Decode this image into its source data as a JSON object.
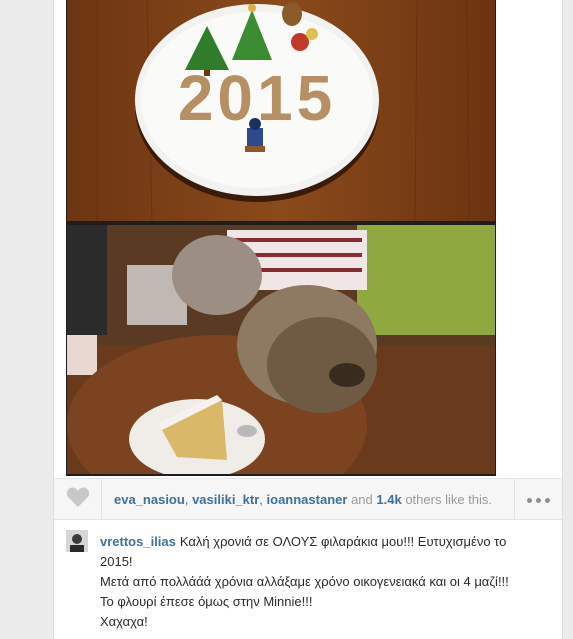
{
  "post": {
    "likers": [
      "eva_nasiou",
      "vasiliki_ktr",
      "ioannastaner"
    ],
    "likes_and": "and",
    "likes_count": "1.4k",
    "likes_suffix": "others like this.",
    "author": "vrettos_ilias",
    "caption_lines": [
      "Καλή χρονιά σε ΟΛΟΥΣ φιλαράκια μου!!! Ευτυχισμένο το",
      "2015!",
      "Μετά από πολλάάά χρόνια αλλάξαμε χρόνο οικογενειακά και οι 4 μαζί!!!",
      "Το φλουρί έπεσε όμως στην Minnie!!!",
      "Χαχαχα!"
    ],
    "cake_text": "2015"
  },
  "icons": {
    "like": "heart-icon",
    "more": "ellipsis-icon"
  },
  "colors": {
    "link": "#3f729b",
    "muted": "#9a9a9a",
    "page_bg": "#ebebeb"
  }
}
